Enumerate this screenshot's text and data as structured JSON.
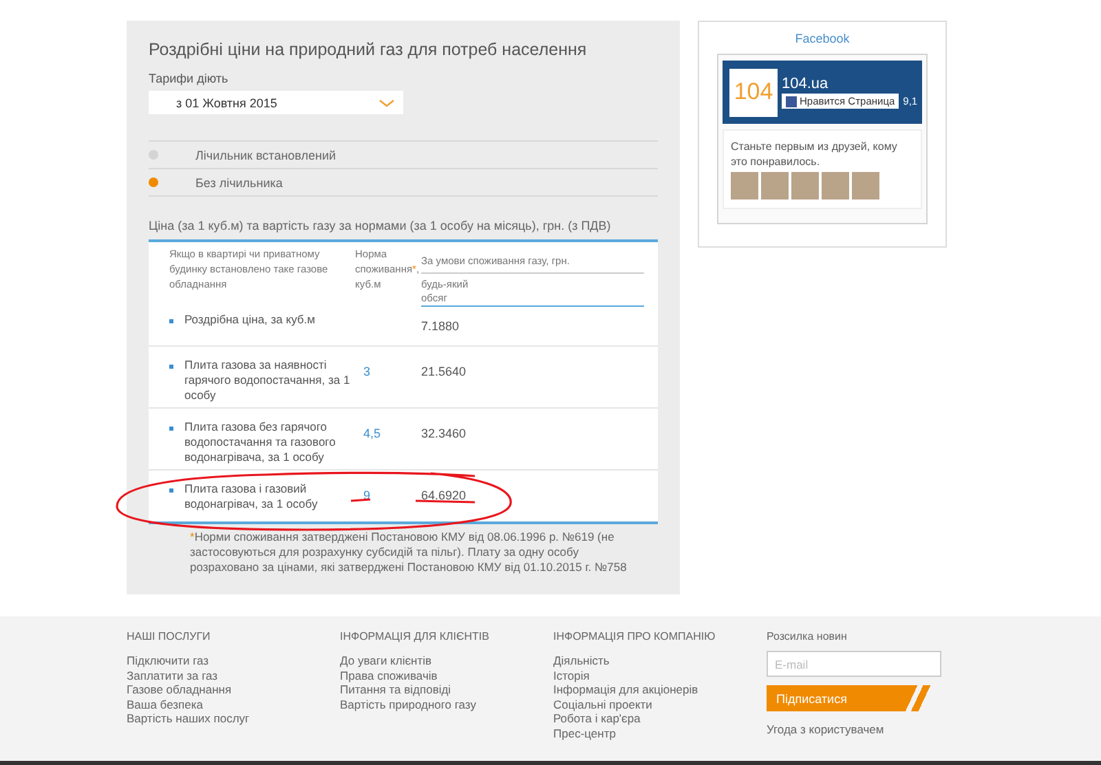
{
  "tariff_panel": {
    "title": "Роздрібні ціни на природний газ для потреб населення",
    "effective_label": "Тарифи діють",
    "date_select": {
      "value": "з 01 Жовтня 2015"
    },
    "options": [
      {
        "label": "Лічильник встановлений",
        "selected": false
      },
      {
        "label": "Без лічильника",
        "selected": true
      }
    ],
    "table_caption": "Ціна (за 1 куб.м) та вартість газу за нормами (за 1 особу на місяць), грн. (з ПДВ)",
    "table": {
      "equipment_header": "Якщо в квартирі чи приватному будинку встановлено таке газове обладнання",
      "norm_header": {
        "label": "Норма споживання",
        "footnote_mark": "*",
        "unit": ", куб.м"
      },
      "price_header": "За умови споживання газу, грн.",
      "price_subheader": "будь-який обсяг",
      "rows": [
        {
          "label": "Роздрібна ціна, за куб.м",
          "norm": "",
          "price": "7.1880",
          "circled": false
        },
        {
          "label": "Плита газова за наявності гарячого водопостачання, за 1 особу",
          "norm": "3",
          "price": "21.5640",
          "circled": false
        },
        {
          "label": "Плита газова без гарячого водопостачання та газового водонагрівача, за 1 особу",
          "norm": "4,5",
          "price": "32.3460",
          "circled": false
        },
        {
          "label": "Плита газова і газовий водонагрівач, за 1 особу",
          "norm": "9",
          "price": "64.6920",
          "circled": true
        }
      ]
    },
    "footnote_mark": "*",
    "footnote": "Норми споживання затверджені Постановою КМУ від 08.06.1996 р. №619 (не застосовуються для розрахунку субсидій та пільг). Плату за одну особу розраховано за цінами, які затверджені Постановою КМУ від 01.10.2015 г. №758"
  },
  "facebook_widget": {
    "title": "Facebook",
    "page_name": "104.ua",
    "logo_text": "104",
    "like_button": "Нравится Страница",
    "like_count": "9,1",
    "friends_text": "Станьте первым из друзей, кому это понравилось."
  },
  "footer": {
    "columns": [
      {
        "heading": "НАШІ ПОСЛУГИ",
        "links": [
          "Підключити газ",
          "Заплатити за газ",
          "Газове обладнання",
          "Ваша безпека",
          "Вартість наших послуг"
        ]
      },
      {
        "heading": "ІНФОРМАЦІЯ ДЛЯ КЛІЄНТІВ",
        "links": [
          "До уваги клієнтів",
          "Права споживачів",
          "Питання та відповіді",
          "Вартість природного газу"
        ]
      },
      {
        "heading": "ІНФОРМАЦІЯ ПРО КОМПАНІЮ",
        "links": [
          "Діяльність",
          "Історія",
          "Інформація для акціонерів",
          "Соціальні проекти",
          "Робота і кар'єра",
          "Прес-центр"
        ]
      }
    ],
    "newsletter": {
      "heading": "Розсилка новин",
      "email_placeholder": "E-mail",
      "subscribe_button": "Підписатися",
      "agreement_link": "Угода з користувачем"
    }
  }
}
